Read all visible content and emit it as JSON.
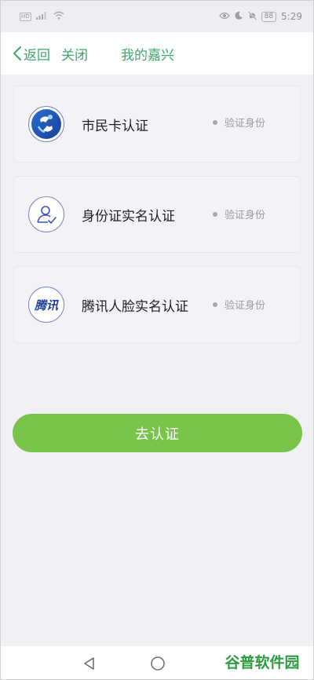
{
  "status_bar": {
    "hd_label": "HD",
    "battery": "88",
    "time": "5:29"
  },
  "nav": {
    "back_label": "返回",
    "close_label": "关闭",
    "title": "我的嘉兴"
  },
  "cards": [
    {
      "label": "市民卡认证",
      "status": "验证身份",
      "icon": "citizen-card-logo-icon"
    },
    {
      "label": "身份证实名认证",
      "status": "验证身份",
      "icon": "person-check-icon"
    },
    {
      "label": "腾讯人脸实名认证",
      "status": "验证身份",
      "icon": "tencent-logo-icon",
      "icon_text": "腾讯"
    }
  ],
  "action": {
    "verify_label": "去认证"
  },
  "watermark": {
    "text": "谷普软件园"
  },
  "colors": {
    "accent_green": "#3aa86a",
    "button_green": "#79c54c",
    "background": "#f0f0f5"
  }
}
